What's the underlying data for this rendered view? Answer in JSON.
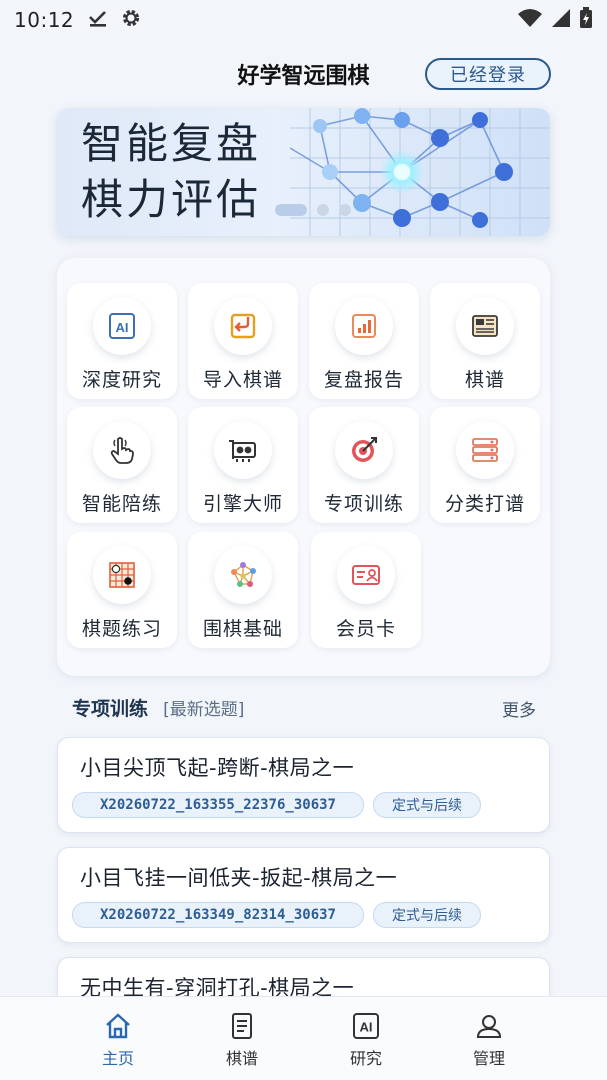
{
  "status": {
    "time": "10:12"
  },
  "header": {
    "title": "好学智远围棋",
    "login_label": "已经登录"
  },
  "banner": {
    "line1": "智能复盘",
    "line2": "棋力评估"
  },
  "features": [
    {
      "label": "深度研究",
      "icon": "ai-chip-icon"
    },
    {
      "label": "导入棋谱",
      "icon": "import-icon"
    },
    {
      "label": "复盘报告",
      "icon": "report-chart-icon"
    },
    {
      "label": "棋谱",
      "icon": "newspaper-icon"
    },
    {
      "label": "智能陪练",
      "icon": "pointing-hand-icon"
    },
    {
      "label": "引擎大师",
      "icon": "robot-icon"
    },
    {
      "label": "专项训练",
      "icon": "target-icon"
    },
    {
      "label": "分类打谱",
      "icon": "category-list-icon"
    },
    {
      "label": "棋题练习",
      "icon": "go-board-icon"
    },
    {
      "label": "围棋基础",
      "icon": "network-icon"
    },
    {
      "label": "会员卡",
      "icon": "member-card-icon"
    }
  ],
  "section": {
    "title": "专项训练",
    "subtitle": "[最新选题]",
    "more": "更多"
  },
  "problems": [
    {
      "title": "小目尖顶飞起-跨断-棋局之一",
      "id": "X20260722_163355_22376_30637",
      "tag": "定式与后续"
    },
    {
      "title": "小目飞挂一间低夹-扳起-棋局之一",
      "id": "X20260722_163349_82314_30637",
      "tag": "定式与后续"
    },
    {
      "title": "无中生有-穿洞打孔-棋局之一"
    }
  ],
  "nav": [
    {
      "label": "主页",
      "icon": "home-icon"
    },
    {
      "label": "棋谱",
      "icon": "document-icon"
    },
    {
      "label": "研究",
      "icon": "ai-box-icon"
    },
    {
      "label": "管理",
      "icon": "user-icon"
    }
  ],
  "colors": {
    "accent": "#2c68b0",
    "navy": "#2c5a8e",
    "chip_bg": "#e9f1fb"
  }
}
